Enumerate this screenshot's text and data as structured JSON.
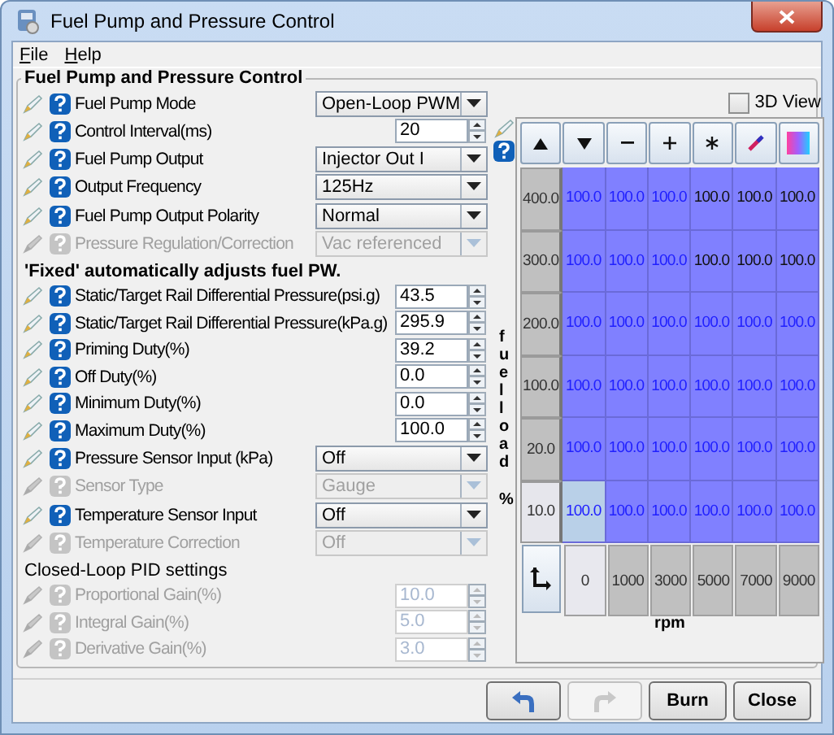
{
  "window": {
    "title": "Fuel Pump and Pressure Control"
  },
  "menu": [
    {
      "label": "File"
    },
    {
      "label": "Help"
    }
  ],
  "group_title": "Fuel Pump and Pressure Control",
  "settings": [
    {
      "kind": "dropdown",
      "label": "Fuel Pump Mode",
      "value": "Open-Loop PWM",
      "disabled": false
    },
    {
      "kind": "spinner",
      "label": "Control Interval(ms)",
      "value": "20",
      "disabled": false
    },
    {
      "kind": "dropdown",
      "label": "Fuel Pump Output",
      "value": "Injector Out I",
      "disabled": false
    },
    {
      "kind": "dropdown",
      "label": "Output Frequency",
      "value": "125Hz",
      "disabled": false
    },
    {
      "kind": "dropdown",
      "label": "Fuel Pump Output Polarity",
      "value": "Normal",
      "disabled": false
    },
    {
      "kind": "dropdown",
      "label": "Pressure Regulation/Correction",
      "value": "Vac referenced",
      "disabled": true
    },
    {
      "kind": "note",
      "label": "'Fixed' automatically adjusts fuel PW."
    },
    {
      "kind": "spinner",
      "label": "Static/Target Rail Differential Pressure(psi.g)",
      "value": "43.5",
      "disabled": false
    },
    {
      "kind": "spinner",
      "label": "Static/Target Rail Differential Pressure(kPa.g)",
      "value": "295.9",
      "disabled": false
    },
    {
      "kind": "spinner",
      "label": "Priming Duty(%)",
      "value": "39.2",
      "disabled": false
    },
    {
      "kind": "spinner",
      "label": "Off Duty(%)",
      "value": "0.0",
      "disabled": false
    },
    {
      "kind": "spinner",
      "label": "Minimum Duty(%)",
      "value": "0.0",
      "disabled": false
    },
    {
      "kind": "spinner",
      "label": "Maximum Duty(%)",
      "value": "100.0",
      "disabled": false
    },
    {
      "kind": "dropdown",
      "label": "Pressure Sensor Input (kPa)",
      "value": "Off",
      "disabled": false
    },
    {
      "kind": "dropdown",
      "label": "Sensor Type",
      "value": "Gauge",
      "disabled": true
    },
    {
      "kind": "dropdown",
      "label": "Temperature Sensor Input",
      "value": "Off",
      "disabled": false
    },
    {
      "kind": "dropdown",
      "label": "Temperature Correction",
      "value": "Off",
      "disabled": true
    },
    {
      "kind": "heading",
      "label": "Closed-Loop PID settings"
    },
    {
      "kind": "spinner",
      "label": "Proportional Gain(%)",
      "value": "10.0",
      "disabled": true
    },
    {
      "kind": "spinner",
      "label": "Integral Gain(%)",
      "value": "5.0",
      "disabled": true
    },
    {
      "kind": "spinner",
      "label": "Derivative Gain(%)",
      "value": "3.0",
      "disabled": true
    }
  ],
  "table": {
    "three_d_view": {
      "label": "3D View",
      "checked": false
    },
    "toolbar": [
      {
        "kind": "increase"
      },
      {
        "kind": "decrease"
      },
      {
        "kind": "subtract"
      },
      {
        "kind": "add"
      },
      {
        "kind": "multiply"
      },
      {
        "kind": "interpolate"
      },
      {
        "kind": "color-scale"
      }
    ],
    "y_label": [
      "fuelload",
      "%"
    ],
    "x_label": "rpm",
    "rows": [
      {
        "label": "400.0",
        "selected": false,
        "cells": [
          {
            "value": "100.0",
            "dark": false
          },
          {
            "value": "100.0",
            "dark": false
          },
          {
            "value": "100.0",
            "dark": false
          },
          {
            "value": "100.0",
            "dark": true
          },
          {
            "value": "100.0",
            "dark": true
          },
          {
            "value": "100.0",
            "dark": true
          }
        ]
      },
      {
        "label": "300.0",
        "selected": false,
        "cells": [
          {
            "value": "100.0",
            "dark": false
          },
          {
            "value": "100.0",
            "dark": false
          },
          {
            "value": "100.0",
            "dark": false
          },
          {
            "value": "100.0",
            "dark": true
          },
          {
            "value": "100.0",
            "dark": true
          },
          {
            "value": "100.0",
            "dark": true
          }
        ]
      },
      {
        "label": "200.0",
        "selected": false,
        "cells": [
          {
            "value": "100.0",
            "dark": false
          },
          {
            "value": "100.0",
            "dark": false
          },
          {
            "value": "100.0",
            "dark": false
          },
          {
            "value": "100.0",
            "dark": false
          },
          {
            "value": "100.0",
            "dark": false
          },
          {
            "value": "100.0",
            "dark": false
          }
        ]
      },
      {
        "label": "100.0",
        "selected": false,
        "cells": [
          {
            "value": "100.0",
            "dark": false
          },
          {
            "value": "100.0",
            "dark": false
          },
          {
            "value": "100.0",
            "dark": false
          },
          {
            "value": "100.0",
            "dark": false
          },
          {
            "value": "100.0",
            "dark": false
          },
          {
            "value": "100.0",
            "dark": false
          }
        ]
      },
      {
        "label": "20.0",
        "selected": false,
        "cells": [
          {
            "value": "100.0",
            "dark": false
          },
          {
            "value": "100.0",
            "dark": false
          },
          {
            "value": "100.0",
            "dark": false
          },
          {
            "value": "100.0",
            "dark": false
          },
          {
            "value": "100.0",
            "dark": false
          },
          {
            "value": "100.0",
            "dark": false
          }
        ]
      },
      {
        "label": "10.0",
        "selected": true,
        "cells": [
          {
            "value": "100.0",
            "dark": false,
            "selected": true
          },
          {
            "value": "100.0",
            "dark": false
          },
          {
            "value": "100.0",
            "dark": false
          },
          {
            "value": "100.0",
            "dark": false
          },
          {
            "value": "100.0",
            "dark": false
          },
          {
            "value": "100.0",
            "dark": false
          }
        ]
      }
    ],
    "x_values": [
      {
        "label": "0",
        "selected": true
      },
      {
        "label": "1000",
        "selected": false
      },
      {
        "label": "3000",
        "selected": false
      },
      {
        "label": "5000",
        "selected": false
      },
      {
        "label": "7000",
        "selected": false
      },
      {
        "label": "9000",
        "selected": false
      }
    ]
  },
  "buttons": [
    {
      "kind": "undo",
      "disabled": false
    },
    {
      "kind": "redo",
      "disabled": true
    },
    {
      "kind": "text",
      "label": "Burn"
    },
    {
      "kind": "text",
      "label": "Close"
    }
  ]
}
